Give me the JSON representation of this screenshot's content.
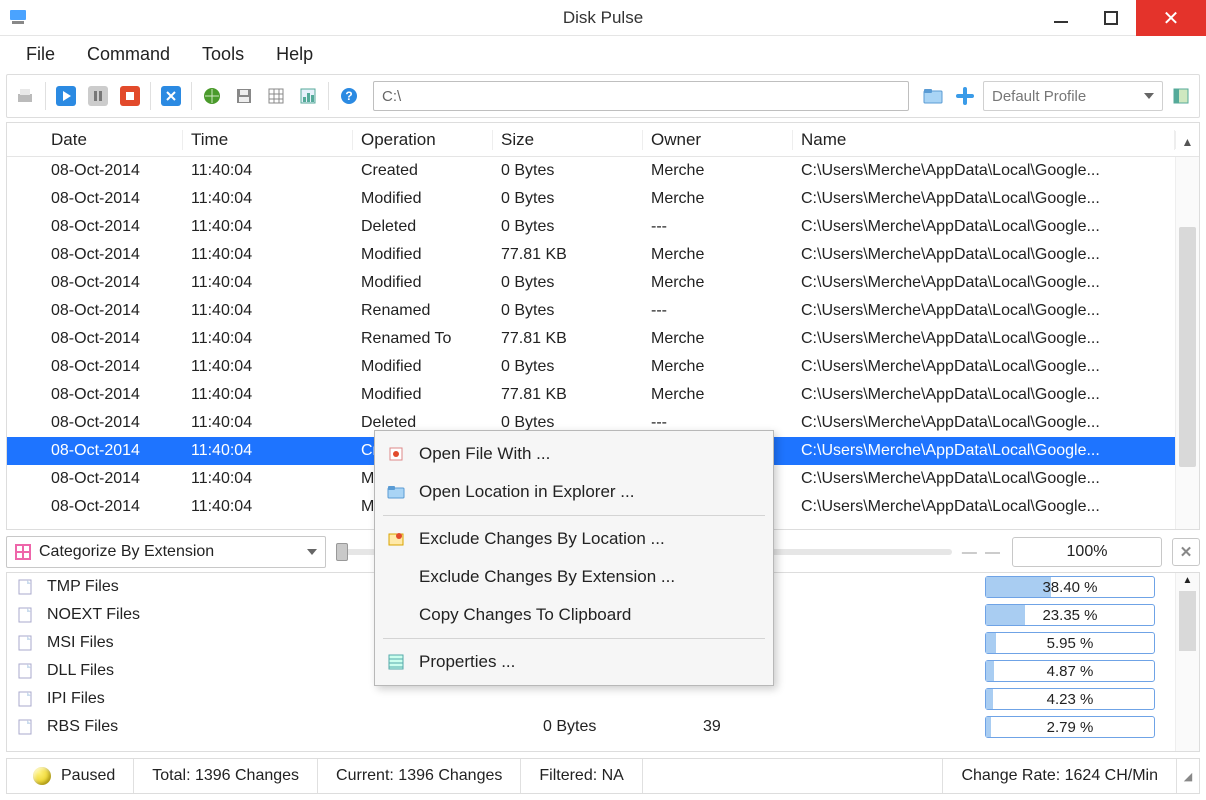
{
  "window": {
    "title": "Disk Pulse"
  },
  "menu": {
    "file": "File",
    "command": "Command",
    "tools": "Tools",
    "help": "Help"
  },
  "toolbar": {
    "address": "C:\\",
    "profile": "Default Profile"
  },
  "grid": {
    "headers": {
      "date": "Date",
      "time": "Time",
      "operation": "Operation",
      "size": "Size",
      "owner": "Owner",
      "name": "Name"
    },
    "rows": [
      {
        "dot": "green",
        "date": "08-Oct-2014",
        "time": "11:40:04",
        "op": "Created",
        "size": "0 Bytes",
        "owner": "Merche",
        "name": "C:\\Users\\Merche\\AppData\\Local\\Google..."
      },
      {
        "dot": "yellow",
        "date": "08-Oct-2014",
        "time": "11:40:04",
        "op": "Modified",
        "size": "0 Bytes",
        "owner": "Merche",
        "name": "C:\\Users\\Merche\\AppData\\Local\\Google..."
      },
      {
        "dot": "red",
        "date": "08-Oct-2014",
        "time": "11:40:04",
        "op": "Deleted",
        "size": "0 Bytes",
        "owner": "---",
        "name": "C:\\Users\\Merche\\AppData\\Local\\Google..."
      },
      {
        "dot": "yellow",
        "date": "08-Oct-2014",
        "time": "11:40:04",
        "op": "Modified",
        "size": "77.81 KB",
        "owner": "Merche",
        "name": "C:\\Users\\Merche\\AppData\\Local\\Google..."
      },
      {
        "dot": "yellow",
        "date": "08-Oct-2014",
        "time": "11:40:04",
        "op": "Modified",
        "size": "0 Bytes",
        "owner": "Merche",
        "name": "C:\\Users\\Merche\\AppData\\Local\\Google..."
      },
      {
        "dot": "orange",
        "date": "08-Oct-2014",
        "time": "11:40:04",
        "op": "Renamed",
        "size": "0 Bytes",
        "owner": "---",
        "name": "C:\\Users\\Merche\\AppData\\Local\\Google..."
      },
      {
        "dot": "orange",
        "date": "08-Oct-2014",
        "time": "11:40:04",
        "op": "Renamed To",
        "size": "77.81 KB",
        "owner": "Merche",
        "name": "C:\\Users\\Merche\\AppData\\Local\\Google..."
      },
      {
        "dot": "yellow",
        "date": "08-Oct-2014",
        "time": "11:40:04",
        "op": "Modified",
        "size": "0 Bytes",
        "owner": "Merche",
        "name": "C:\\Users\\Merche\\AppData\\Local\\Google..."
      },
      {
        "dot": "yellow",
        "date": "08-Oct-2014",
        "time": "11:40:04",
        "op": "Modified",
        "size": "77.81 KB",
        "owner": "Merche",
        "name": "C:\\Users\\Merche\\AppData\\Local\\Google..."
      },
      {
        "dot": "red",
        "date": "08-Oct-2014",
        "time": "11:40:04",
        "op": "Deleted",
        "size": "0 Bytes",
        "owner": "---",
        "name": "C:\\Users\\Merche\\AppData\\Local\\Google..."
      },
      {
        "dot": "green",
        "date": "08-Oct-2014",
        "time": "11:40:04",
        "op": "Cre",
        "size": "",
        "owner": "",
        "name": "C:\\Users\\Merche\\AppData\\Local\\Google...",
        "selected": true
      },
      {
        "dot": "yellow",
        "date": "08-Oct-2014",
        "time": "11:40:04",
        "op": "Mo",
        "size": "",
        "owner": "",
        "name": "C:\\Users\\Merche\\AppData\\Local\\Google..."
      },
      {
        "dot": "yellow",
        "date": "08-Oct-2014",
        "time": "11:40:04",
        "op": "Mo",
        "size": "",
        "owner": "",
        "name": "C:\\Users\\Merche\\AppData\\Local\\Google..."
      }
    ]
  },
  "categorize": {
    "selector": "Categorize By Extension",
    "percent": "100%",
    "rows": [
      {
        "label": "TMP Files",
        "size": "",
        "count": "",
        "pct_text": "38.40 %",
        "pct": 38.4
      },
      {
        "label": "NOEXT Files",
        "size": "",
        "count": "",
        "pct_text": "23.35 %",
        "pct": 23.35
      },
      {
        "label": "MSI Files",
        "size": "",
        "count": "",
        "pct_text": "5.95 %",
        "pct": 5.95
      },
      {
        "label": "DLL Files",
        "size": "",
        "count": "",
        "pct_text": "4.87 %",
        "pct": 4.87
      },
      {
        "label": "IPI Files",
        "size": "",
        "count": "",
        "pct_text": "4.23 %",
        "pct": 4.23
      },
      {
        "label": "RBS Files",
        "size": "0 Bytes",
        "count": "39",
        "pct_text": "2.79 %",
        "pct": 2.79
      }
    ]
  },
  "context_menu": {
    "open_file": "Open File With ...",
    "open_location": "Open Location in Explorer ...",
    "exclude_loc": "Exclude Changes By Location ...",
    "exclude_ext": "Exclude Changes By Extension ...",
    "copy_clip": "Copy Changes To Clipboard",
    "properties": "Properties ..."
  },
  "status": {
    "state": "Paused",
    "total": "Total: 1396 Changes",
    "current": "Current: 1396 Changes",
    "filtered": "Filtered: NA",
    "rate": "Change Rate: 1624 CH/Min"
  }
}
